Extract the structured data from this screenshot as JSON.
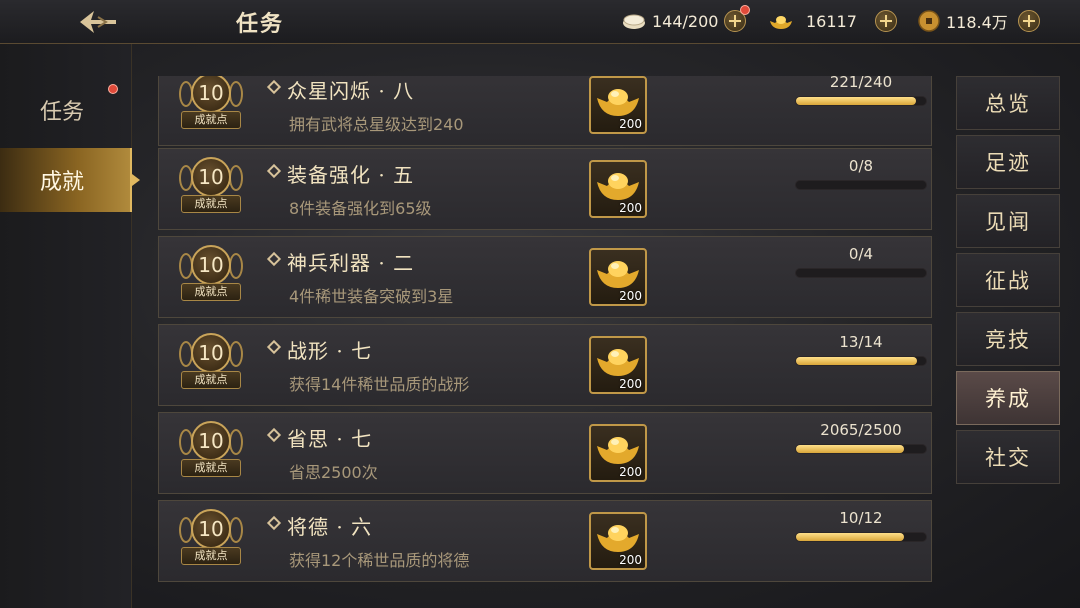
{
  "header": {
    "title": "任务",
    "back_icon": "back-arrow-icon",
    "resources": [
      {
        "icon": "coin-pile-icon",
        "value": "144/200",
        "has_dot": true
      },
      {
        "icon": "gold-ingot-icon",
        "value": "16117",
        "has_dot": false
      },
      {
        "icon": "copper-coin-icon",
        "value": "118.4万",
        "has_dot": false
      }
    ]
  },
  "left_tabs": [
    {
      "label": "任务",
      "active": false,
      "has_dot": true
    },
    {
      "label": "成就",
      "active": true,
      "has_dot": false
    }
  ],
  "achievements": [
    {
      "points": "10",
      "points_label": "成就点",
      "name": "众星闪烁 · 八",
      "desc": "拥有武将总星级达到240",
      "reward_icon": "gold-ingot-icon",
      "reward_count": "200",
      "progress_text": "221/240",
      "progress": 0.92
    },
    {
      "points": "10",
      "points_label": "成就点",
      "name": "装备强化 · 五",
      "desc": "8件装备强化到65级",
      "reward_icon": "gold-ingot-icon",
      "reward_count": "200",
      "progress_text": "0/8",
      "progress": 0
    },
    {
      "points": "10",
      "points_label": "成就点",
      "name": "神兵利器 · 二",
      "desc": "4件稀世装备突破到3星",
      "reward_icon": "gold-ingot-icon",
      "reward_count": "200",
      "progress_text": "0/4",
      "progress": 0
    },
    {
      "points": "10",
      "points_label": "成就点",
      "name": "战形 · 七",
      "desc": "获得14件稀世品质的战形",
      "reward_icon": "gold-ingot-icon",
      "reward_count": "200",
      "progress_text": "13/14",
      "progress": 0.93
    },
    {
      "points": "10",
      "points_label": "成就点",
      "name": "省思 · 七",
      "desc": "省思2500次",
      "reward_icon": "gold-ingot-icon",
      "reward_count": "200",
      "progress_text": "2065/2500",
      "progress": 0.83
    },
    {
      "points": "10",
      "points_label": "成就点",
      "name": "将德 · 六",
      "desc": "获得12个稀世品质的将德",
      "reward_icon": "gold-ingot-icon",
      "reward_count": "200",
      "progress_text": "10/12",
      "progress": 0.83
    }
  ],
  "right_tabs": [
    {
      "label": "总览",
      "active": false
    },
    {
      "label": "足迹",
      "active": false
    },
    {
      "label": "见闻",
      "active": false
    },
    {
      "label": "征战",
      "active": false
    },
    {
      "label": "竞技",
      "active": false
    },
    {
      "label": "养成",
      "active": true
    },
    {
      "label": "社交",
      "active": false
    }
  ],
  "colors": {
    "accent_gold": "#d9a63a",
    "notify_red": "#e04a3a"
  }
}
